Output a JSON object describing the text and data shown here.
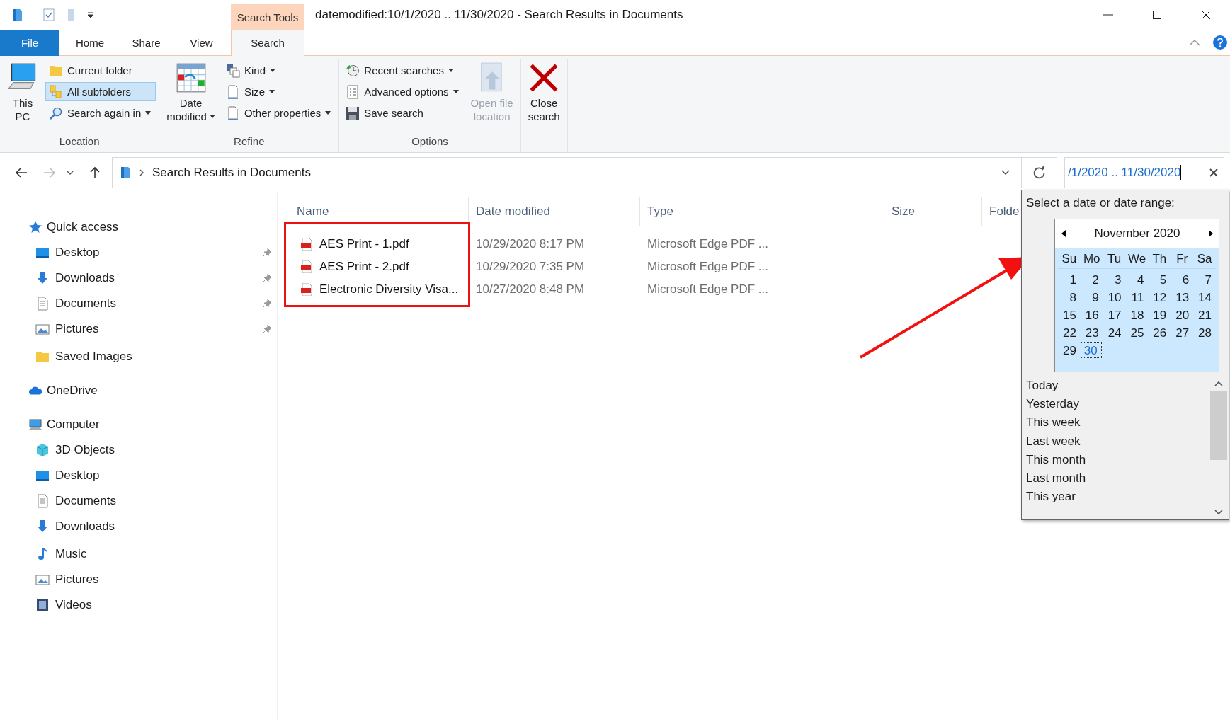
{
  "window": {
    "title": "datemodified:10/1/2020 .. 11/30/2020 - Search Results in Documents",
    "contextual_tab": "Search Tools"
  },
  "tabs": [
    {
      "label": "File",
      "kind": "file",
      "selected": false
    },
    {
      "label": "Home",
      "kind": "tab",
      "selected": false
    },
    {
      "label": "Share",
      "kind": "tab",
      "selected": false
    },
    {
      "label": "View",
      "kind": "tab",
      "selected": false
    },
    {
      "label": "Search",
      "kind": "tab",
      "selected": true
    }
  ],
  "ribbon": {
    "groups": [
      {
        "label": "Location",
        "items": [
          {
            "kind": "large",
            "lines": [
              "This",
              "PC"
            ],
            "dropdown": false,
            "disabled": false
          },
          {
            "kind": "small",
            "label": "Current folder",
            "selected": false,
            "dropdown": false
          },
          {
            "kind": "small",
            "label": "All subfolders",
            "selected": true,
            "dropdown": false
          },
          {
            "kind": "small",
            "label": "Search again in",
            "selected": false,
            "dropdown": true
          }
        ]
      },
      {
        "label": "Refine",
        "items": [
          {
            "kind": "large",
            "lines": [
              "Date",
              "modified"
            ],
            "dropdown": true,
            "disabled": false
          },
          {
            "kind": "small",
            "label": "Kind",
            "selected": false,
            "dropdown": true
          },
          {
            "kind": "small",
            "label": "Size",
            "selected": false,
            "dropdown": true
          },
          {
            "kind": "small",
            "label": "Other properties",
            "selected": false,
            "dropdown": true
          }
        ]
      },
      {
        "label": "Options",
        "items": [
          {
            "kind": "small",
            "label": "Recent searches",
            "selected": false,
            "dropdown": true
          },
          {
            "kind": "small",
            "label": "Advanced options",
            "selected": false,
            "dropdown": true
          },
          {
            "kind": "small",
            "label": "Save search",
            "selected": false,
            "dropdown": false
          },
          {
            "kind": "large",
            "lines": [
              "Open file",
              "location"
            ],
            "dropdown": false,
            "disabled": true
          }
        ]
      },
      {
        "items": [
          {
            "kind": "large",
            "lines": [
              "Close",
              "search"
            ],
            "dropdown": false,
            "disabled": false
          }
        ]
      }
    ]
  },
  "address_bar": {
    "path": "Search Results in Documents",
    "search_value": "/1/2020 .. 11/30/2020"
  },
  "navigation": [
    {
      "label": "Quick access",
      "children": [
        {
          "label": "Desktop",
          "pinned": true
        },
        {
          "label": "Downloads",
          "pinned": true
        },
        {
          "label": "Documents",
          "pinned": true
        },
        {
          "label": "Pictures",
          "pinned": true
        },
        {
          "label": "Saved Images",
          "pinned": false
        }
      ]
    },
    {
      "label": "OneDrive"
    },
    {
      "label": "Computer",
      "children": [
        {
          "label": "3D Objects",
          "pinned": false
        },
        {
          "label": "Desktop",
          "pinned": false
        },
        {
          "label": "Documents",
          "pinned": false
        },
        {
          "label": "Downloads",
          "pinned": false
        },
        {
          "label": "Music",
          "pinned": false
        },
        {
          "label": "Pictures",
          "pinned": false
        },
        {
          "label": "Videos",
          "pinned": false
        }
      ]
    }
  ],
  "table": {
    "columns": [
      "Name",
      "Date modified",
      "Type",
      "",
      "Size",
      "Folde"
    ],
    "rows": [
      {
        "name": "AES Print - 1.pdf",
        "date_modified": "10/29/2020 8:17 PM",
        "type": "Microsoft Edge PDF ..."
      },
      {
        "name": "AES Print - 2.pdf",
        "date_modified": "10/29/2020 7:35 PM",
        "type": "Microsoft Edge PDF ..."
      },
      {
        "name": "Electronic Diversity Visa...",
        "date_modified": "10/27/2020 8:48 PM",
        "type": "Microsoft Edge PDF ..."
      }
    ]
  },
  "date_picker": {
    "prompt": "Select a date or date range:",
    "month": "November 2020",
    "weekdays": [
      "Su",
      "Mo",
      "Tu",
      "We",
      "Th",
      "Fr",
      "Sa"
    ],
    "days": [
      {
        "day": "1",
        "selected": false
      },
      {
        "day": "2",
        "selected": false
      },
      {
        "day": "3",
        "selected": false
      },
      {
        "day": "4",
        "selected": false
      },
      {
        "day": "5",
        "selected": false
      },
      {
        "day": "6",
        "selected": false
      },
      {
        "day": "7",
        "selected": false
      },
      {
        "day": "8",
        "selected": false
      },
      {
        "day": "9",
        "selected": false
      },
      {
        "day": "10",
        "selected": false
      },
      {
        "day": "11",
        "selected": false
      },
      {
        "day": "12",
        "selected": false
      },
      {
        "day": "13",
        "selected": false
      },
      {
        "day": "14",
        "selected": false
      },
      {
        "day": "15",
        "selected": false
      },
      {
        "day": "16",
        "selected": false
      },
      {
        "day": "17",
        "selected": false
      },
      {
        "day": "18",
        "selected": false
      },
      {
        "day": "19",
        "selected": false
      },
      {
        "day": "20",
        "selected": false
      },
      {
        "day": "21",
        "selected": false
      },
      {
        "day": "22",
        "selected": false
      },
      {
        "day": "23",
        "selected": false
      },
      {
        "day": "24",
        "selected": false
      },
      {
        "day": "25",
        "selected": false
      },
      {
        "day": "26",
        "selected": false
      },
      {
        "day": "27",
        "selected": false
      },
      {
        "day": "28",
        "selected": false
      },
      {
        "day": "29",
        "selected": false
      },
      {
        "day": "30",
        "selected": true
      }
    ],
    "presets": [
      {
        "label": "Today",
        "selected": false
      },
      {
        "label": "Yesterday",
        "selected": false
      },
      {
        "label": "This week",
        "selected": false
      },
      {
        "label": "Last week",
        "selected": false
      },
      {
        "label": "This month",
        "selected": false
      },
      {
        "label": "Last month",
        "selected": false
      },
      {
        "label": "This year",
        "selected": false
      }
    ]
  }
}
